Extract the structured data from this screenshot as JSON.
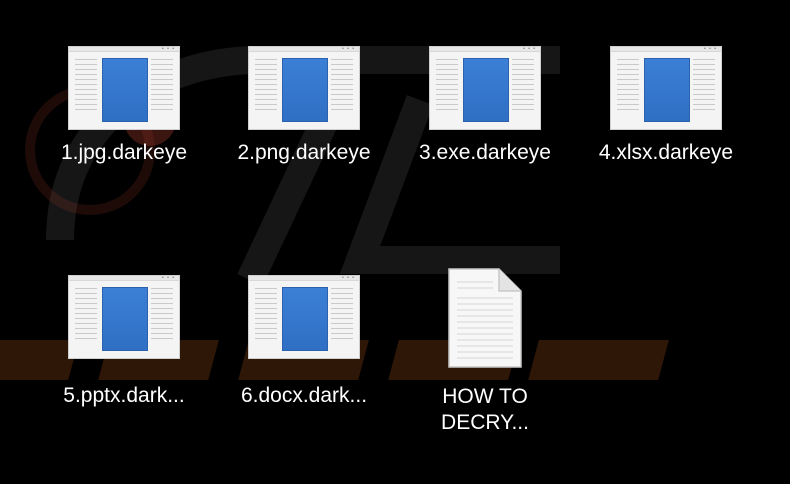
{
  "window": {
    "background": "#000000"
  },
  "icons": {
    "thumbnail": "document-thumbnail-icon",
    "text_file": "text-file-icon"
  },
  "colors": {
    "page_accent": "#2f6fc4"
  },
  "files": [
    {
      "label": "1.jpg.darkeye"
    },
    {
      "label": "2.png.darkeye"
    },
    {
      "label": "3.exe.darkeye"
    },
    {
      "label": "4.xlsx.darkeye"
    },
    {
      "label": "5.pptx.dark..."
    },
    {
      "label": "6.docx.dark..."
    },
    {
      "label_line1": "HOW TO",
      "label_line2": "DECRY..."
    }
  ]
}
